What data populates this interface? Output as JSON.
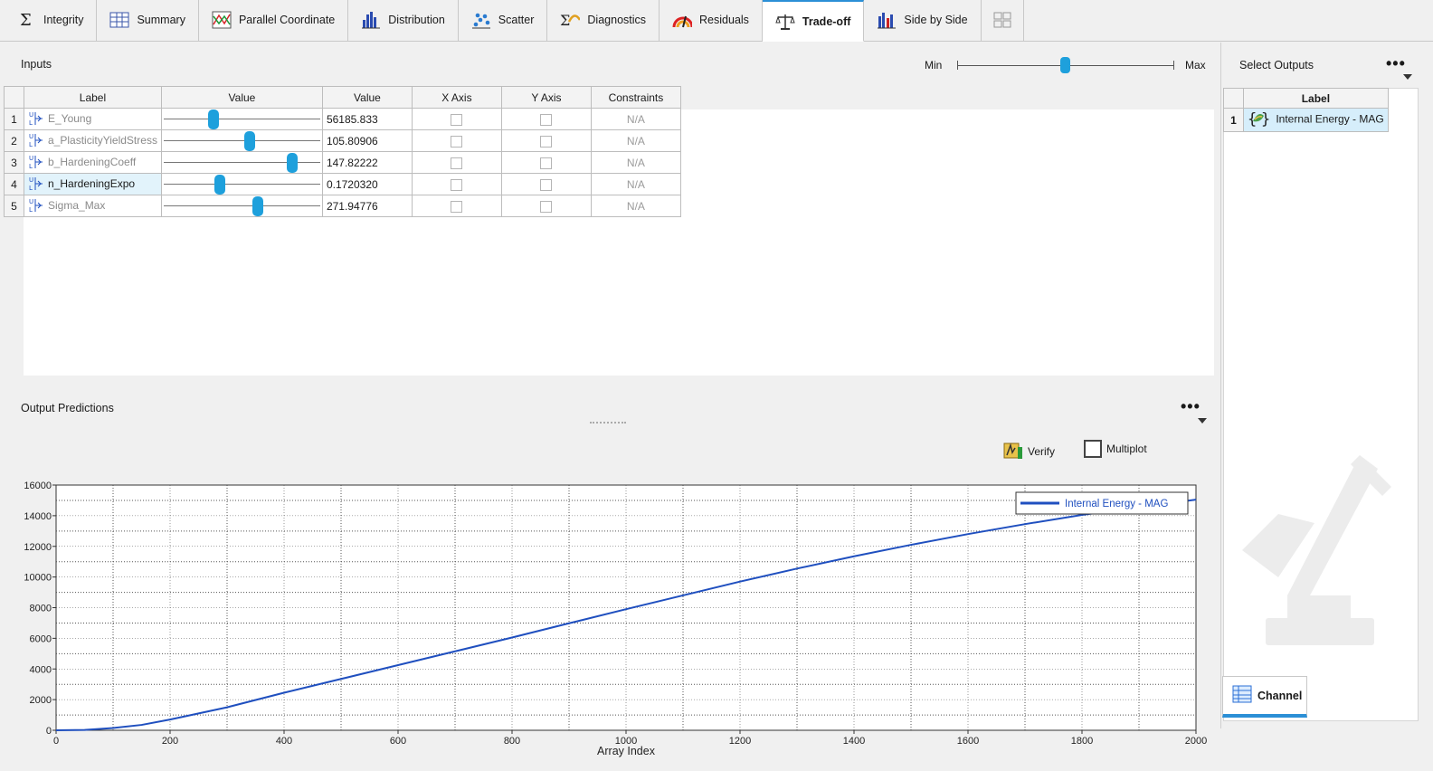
{
  "tabs": [
    {
      "label": "Integrity",
      "icon": "sigma-icon"
    },
    {
      "label": "Summary",
      "icon": "table-icon"
    },
    {
      "label": "Parallel Coordinate",
      "icon": "parallel-coordinate-icon"
    },
    {
      "label": "Distribution",
      "icon": "histogram-icon"
    },
    {
      "label": "Scatter",
      "icon": "scatter-icon"
    },
    {
      "label": "Diagnostics",
      "icon": "diagnostics-icon"
    },
    {
      "label": "Residuals",
      "icon": "residuals-icon"
    },
    {
      "label": "Trade-off",
      "icon": "balance-scale-icon",
      "active": true
    },
    {
      "label": "Side by Side",
      "icon": "side-by-side-icon"
    }
  ],
  "inputs": {
    "title": "Inputs",
    "min_label": "Min",
    "max_label": "Max",
    "columns": [
      "Label",
      "Value",
      "Value",
      "X Axis",
      "Y Axis",
      "Constraints"
    ],
    "rows": [
      {
        "index": "1",
        "label": "E_Young",
        "slider": 0.31,
        "value": "56185.833",
        "constraint": "N/A"
      },
      {
        "index": "2",
        "label": "a_PlasticityYieldStress",
        "slider": 0.55,
        "value": "105.80906",
        "constraint": "N/A"
      },
      {
        "index": "3",
        "label": "b_HardeningCoeff",
        "slider": 0.83,
        "value": "147.82222",
        "constraint": "N/A",
        "selected_row": true
      },
      {
        "index": "4",
        "label": "n_HardeningExpo",
        "slider": 0.35,
        "value": "0.1720320",
        "constraint": "N/A",
        "selected": true
      },
      {
        "index": "5",
        "label": "Sigma_Max",
        "slider": 0.6,
        "value": "271.94776",
        "constraint": "N/A"
      }
    ]
  },
  "output": {
    "title": "Output Predictions",
    "verify_label": "Verify",
    "multiplot_label": "Multiplot"
  },
  "select_outputs": {
    "title": "Select Outputs",
    "column": "Label",
    "rows": [
      {
        "index": "1",
        "label": "Internal Energy - MAG"
      }
    ]
  },
  "channel_tab": "Channel",
  "colors": {
    "accent": "#2b8fd6",
    "slider": "#1ea0dc",
    "series": "#1f4fbf"
  },
  "chart_data": {
    "type": "line",
    "xlabel": "Array Index",
    "ylabel": "",
    "xlim": [
      0,
      2000
    ],
    "ylim": [
      0,
      16000
    ],
    "xticks": [
      0,
      200,
      400,
      600,
      800,
      1000,
      1200,
      1400,
      1600,
      1800,
      2000
    ],
    "yticks": [
      0,
      2000,
      4000,
      6000,
      8000,
      10000,
      12000,
      14000,
      16000
    ],
    "grid": true,
    "legend": "top-right",
    "series": [
      {
        "name": "Internal Energy - MAG",
        "x": [
          0,
          50,
          100,
          150,
          200,
          300,
          400,
          500,
          600,
          700,
          800,
          900,
          1000,
          1100,
          1200,
          1300,
          1400,
          1500,
          1600,
          1700,
          1800,
          1900,
          2000
        ],
        "y": [
          0,
          20,
          150,
          350,
          700,
          1500,
          2450,
          3350,
          4250,
          5150,
          6050,
          6980,
          7900,
          8800,
          9700,
          10550,
          11350,
          12100,
          12800,
          13450,
          14050,
          14550,
          15050
        ]
      }
    ]
  }
}
